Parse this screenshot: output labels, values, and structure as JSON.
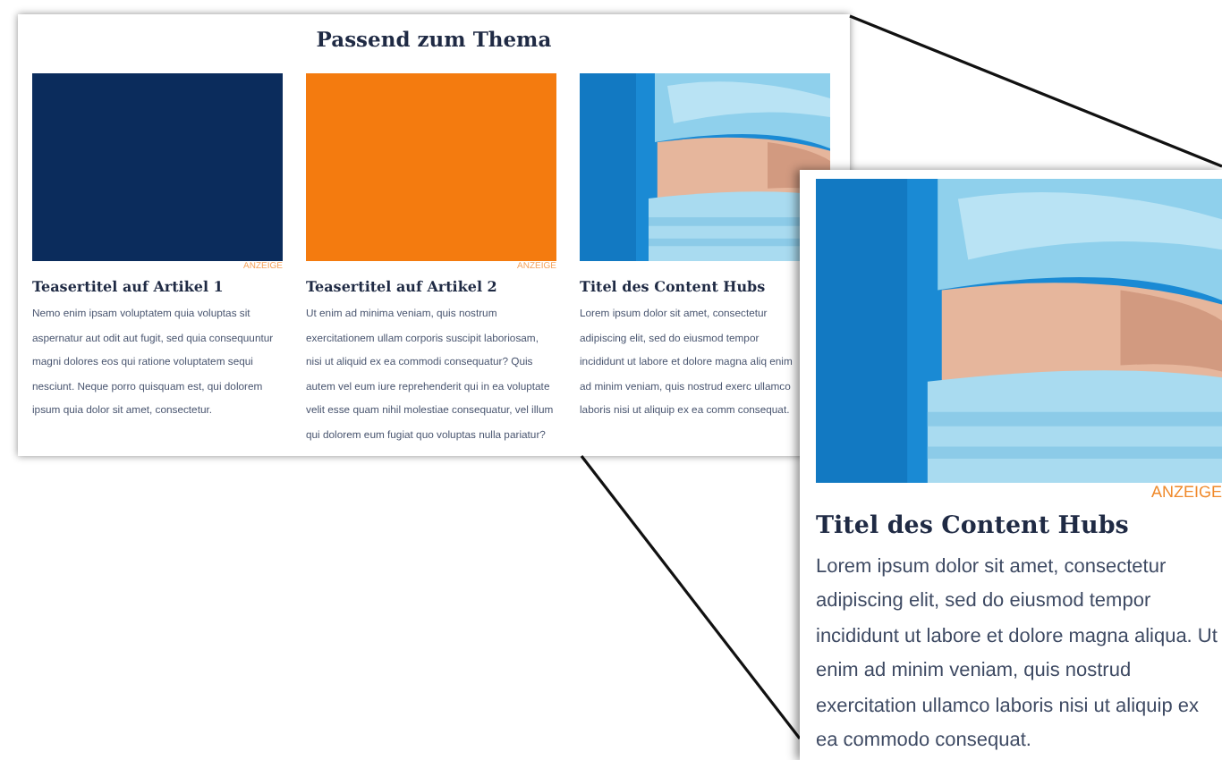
{
  "section_title": "Passend zum Thema",
  "teasers": [
    {
      "kind": "block",
      "color": "#0b2c5c",
      "ad_label": "ANZEIGE",
      "title": "Teasertitel auf Artikel 1",
      "body": "Nemo enim ipsam voluptatem quia voluptas sit aspernatur aut odit aut fugit, sed quia consequuntur magni dolores eos qui ratione voluptatem sequi nesciunt. Neque porro quisquam est, qui dolorem ipsum quia dolor sit amet, consectetur."
    },
    {
      "kind": "block",
      "color": "#f47b0f",
      "ad_label": "ANZEIGE",
      "title": "Teasertitel auf Artikel 2",
      "body": "Ut enim ad minima veniam, quis nostrum exercitationem ullam corporis suscipit laboriosam, nisi ut aliquid ex ea commodi consequatur? Quis autem vel eum iure reprehenderit qui in ea voluptate velit esse quam nihil molestiae consequatur, vel illum qui dolorem eum fugiat quo voluptas nulla pariatur?"
    },
    {
      "kind": "picture",
      "title": "Titel des Content Hubs",
      "body": "Lorem ipsum dolor sit amet, consectetur adipiscing elit, sed do eiusmod tempor incididunt ut labore et dolore magna aliq enim ad minim veniam, quis nostrud exerc ullamco laboris nisi ut aliquip ex ea comm consequat."
    }
  ],
  "callout": {
    "kind": "picture",
    "ad_label": "ANZEIGE",
    "title": "Titel des Content Hubs",
    "body": "Lorem ipsum dolor sit amet, consectetur adipiscing elit, sed do eiusmod tempor incididunt ut labore et dolore magna aliqua. Ut enim ad minim veniam, quis nostrud exercitation ullamco laboris nisi ut aliquip ex ea commodo consequat."
  }
}
